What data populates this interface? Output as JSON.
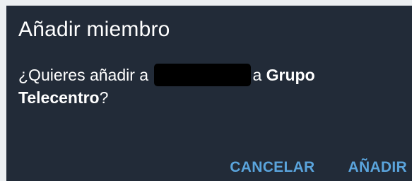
{
  "dialog": {
    "title": "Añadir miembro",
    "message_prefix": "¿Quieres añadir a",
    "message_middle": "a",
    "group_name": "Grupo Telecentro",
    "message_suffix": "?",
    "cancel_label": "CANCELAR",
    "confirm_label": "AÑADIR"
  },
  "colors": {
    "dialog_background": "#222b38",
    "text": "#ffffff",
    "accent": "#5aa4dc",
    "redaction": "#000000"
  }
}
